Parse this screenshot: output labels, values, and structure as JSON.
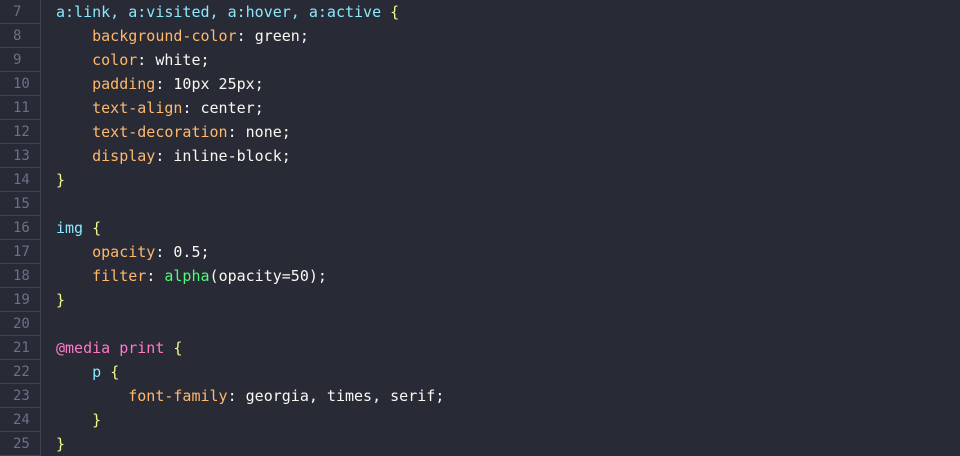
{
  "editor": {
    "line_numbers": [
      "7",
      "8",
      "9",
      "10",
      "11",
      "12",
      "13",
      "14",
      "15",
      "16",
      "17",
      "18",
      "19",
      "20",
      "21",
      "22",
      "23",
      "24",
      "25"
    ],
    "lines": {
      "l7": {
        "selector": "a:link, a:visited, a:hover, a:active",
        "brace": "{"
      },
      "l8": {
        "prop": "background-color",
        "value": "green"
      },
      "l9": {
        "prop": "color",
        "value": "white"
      },
      "l10": {
        "prop": "padding",
        "value": "10px 25px"
      },
      "l11": {
        "prop": "text-align",
        "value": "center"
      },
      "l12": {
        "prop": "text-decoration",
        "value": "none"
      },
      "l13": {
        "prop": "display",
        "value": "inline-block"
      },
      "l14": {
        "brace": "}"
      },
      "l16": {
        "selector": "img",
        "brace": "{"
      },
      "l17": {
        "prop": "opacity",
        "value": "0.5"
      },
      "l18": {
        "prop": "filter",
        "func": "alpha",
        "arg": "opacity=50"
      },
      "l19": {
        "brace": "}"
      },
      "l21": {
        "at": "@media",
        "media": "print",
        "brace": "{"
      },
      "l22": {
        "selector": "p",
        "brace": "{"
      },
      "l23": {
        "prop": "font-family",
        "value": "georgia, times, serif"
      },
      "l24": {
        "brace": "}"
      },
      "l25": {
        "brace": "}"
      }
    }
  },
  "colors": {
    "background": "#282a36",
    "selector": "#8be9fd",
    "property": "#ffb86c",
    "brace": "#f1fa8c",
    "function": "#50fa7b",
    "at_rule": "#ff79c6"
  }
}
